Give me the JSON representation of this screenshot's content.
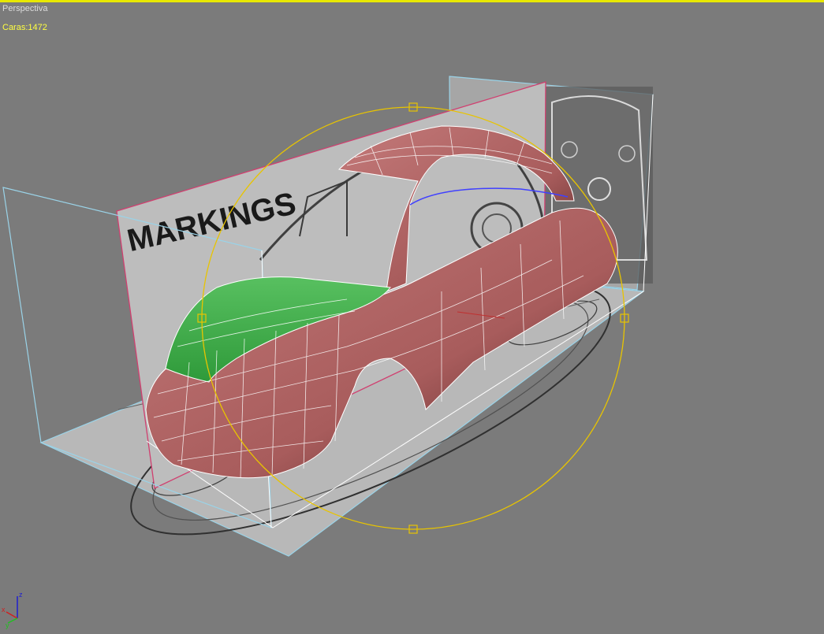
{
  "viewport": {
    "label": "Perspectiva",
    "faces_label": "Caras:",
    "faces_count": "1472",
    "active_border_color": "#e8e800",
    "background_color": "#7b7b7b"
  },
  "reference_planes": {
    "side_text": "MARKINGS"
  },
  "model": {
    "body_color": "#b06464",
    "selected_color": "#3fae4a",
    "wire_color": "#ffffff",
    "edge_color": "#4040ff"
  },
  "gizmo": {
    "color": "#e8c400"
  },
  "axis_tripod": {
    "x_label": "x",
    "y_label": "y",
    "z_label": "z",
    "x_color": "#d02020",
    "y_color": "#20c020",
    "z_color": "#2020d0"
  }
}
